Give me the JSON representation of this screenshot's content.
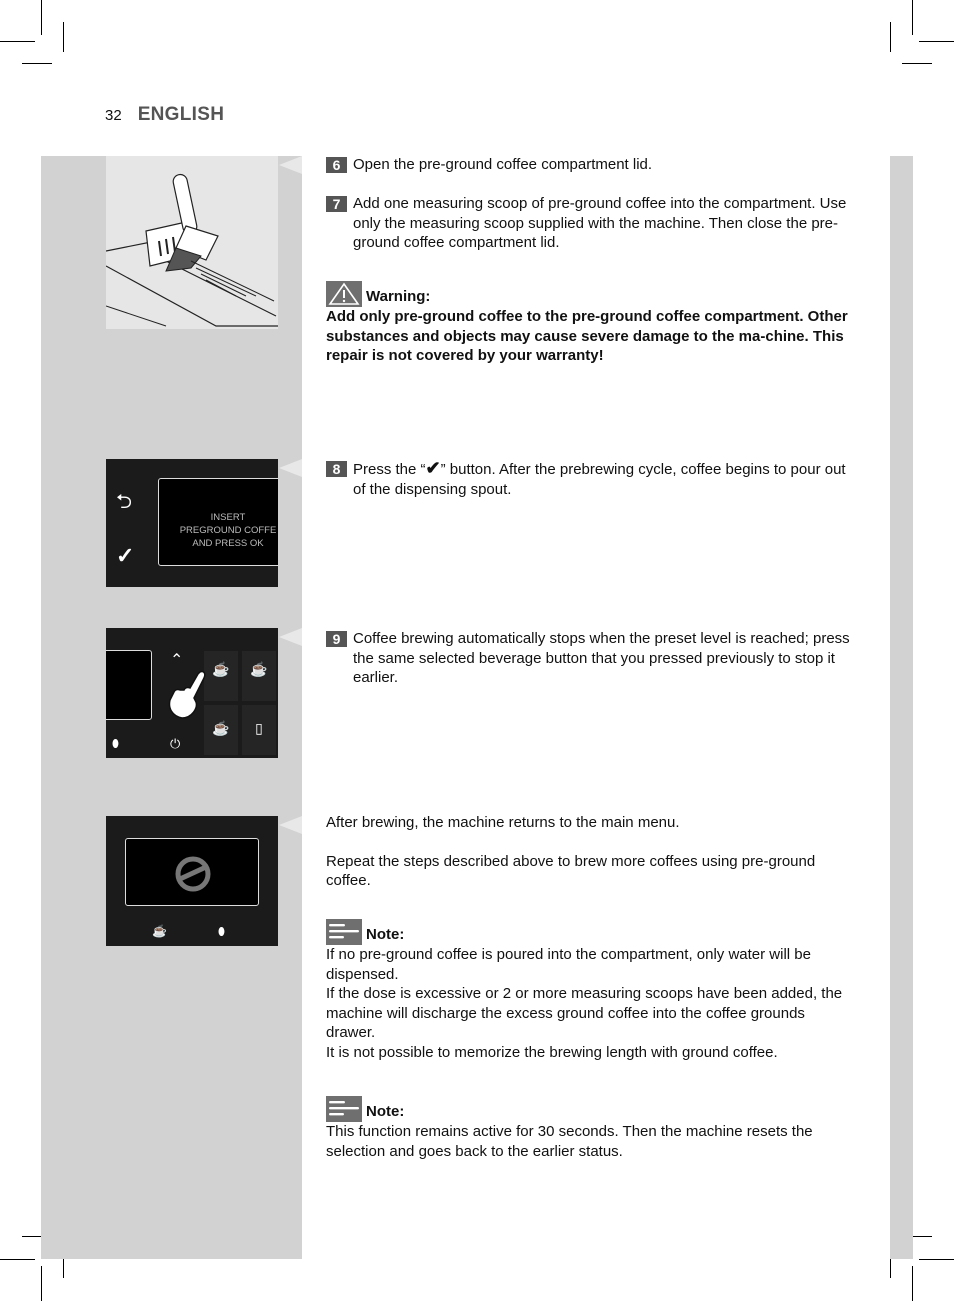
{
  "header": {
    "page_number": "32",
    "language": "ENGLISH"
  },
  "steps": [
    {
      "number": "6",
      "text": "Open the pre-ground coffee compartment lid."
    },
    {
      "number": "7",
      "text": "Add one measuring scoop of pre-ground coffee into the compartment. Use only the measuring scoop supplied with the machine. Then close the pre-ground coffee compartment lid."
    },
    {
      "number": "8",
      "text_before": "Press the “",
      "text_after": "” button. After the prebrewing cycle, coffee begins to pour out of the dispensing spout."
    },
    {
      "number": "9",
      "text": "Coffee brewing automatically stops when the preset level is reached; press the same selected beverage button that you pressed previously to stop it earlier."
    }
  ],
  "warning": {
    "icon": "warning-triangle-icon",
    "title": "Warning:",
    "text": "Add only pre-ground coffee to the pre-ground coffee compartment. Other substances and objects may cause severe damage to the ma-chine. This repair is not covered by your warranty!"
  },
  "after_brewing": {
    "line1": "After brewing, the machine returns to the main menu.",
    "line2": "Repeat the steps described above to brew more coffees using pre-ground coffee."
  },
  "notes": [
    {
      "icon": "note-lines-icon",
      "title": "Note:",
      "lines": [
        "If no pre-ground coffee is poured into the compartment, only water will be dispensed.",
        "If the dose is excessive or 2 or more measuring scoops have been added, the machine will discharge the excess ground coffee into the coffee grounds drawer.",
        "It is not possible to memorize the brewing length with ground coffee."
      ]
    },
    {
      "icon": "note-lines-icon",
      "title": "Note:",
      "lines": [
        "This function remains active for 30 seconds. Then the machine resets the selection and goes back to the earlier status."
      ]
    }
  ],
  "figures": {
    "display_message": {
      "line1": "INSERT",
      "line2": "PREGROUND COFFE",
      "line3": "AND PRESS OK"
    }
  }
}
